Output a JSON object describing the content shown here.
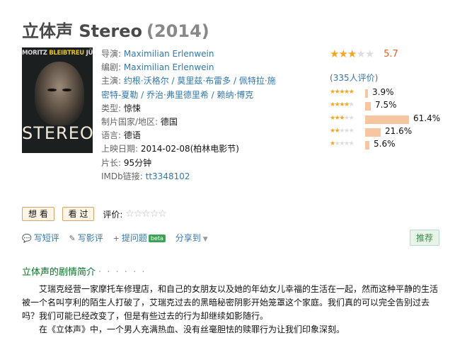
{
  "title": {
    "name": "立体声 Stereo",
    "year": "(2014)"
  },
  "poster": {
    "names_pre": "MORITZ ",
    "names_hl": "BLEIBTREU",
    "names_post": " JÜRGEN VOGEL",
    "logo": "STEREO"
  },
  "info": {
    "director_label": "导演:",
    "director": "Maximilian Erlenwein",
    "writer_label": "编剧:",
    "writer": "Maximilian Erlenwein",
    "cast_label": "主演:",
    "cast_line1": "约根·沃格尔 / 莫里兹·布雷多 / 佩特拉·施",
    "cast_line2": "密特-夏勒 / 乔治·弗里德里希 / 赖纳·博克",
    "genre_label": "类型:",
    "genre": "惊悚",
    "country_label": "制片国家/地区:",
    "country": "德国",
    "language_label": "语言:",
    "language": "德语",
    "release_label": "上映日期:",
    "release": "2014-02-08(柏林电影节)",
    "runtime_label": "片长:",
    "runtime": "95分钟",
    "imdb_label": "IMDb链接:",
    "imdb": "tt3348102"
  },
  "rating": {
    "score": "5.7",
    "stars_filled": 3,
    "count_prefix": "(",
    "count_link": "335人评价",
    "count_suffix": ")",
    "breakdown": [
      {
        "stars": 5,
        "percent": 3.9,
        "label": "3.9%"
      },
      {
        "stars": 4,
        "percent": 7.5,
        "label": "7.5%"
      },
      {
        "stars": 3,
        "percent": 61.4,
        "label": "61.4%"
      },
      {
        "stars": 2,
        "percent": 21.6,
        "label": "21.6%"
      },
      {
        "stars": 1,
        "percent": 5.6,
        "label": "5.6%"
      }
    ]
  },
  "buttons": {
    "want": "想 看",
    "seen": "看 过",
    "rate_label": "评价:"
  },
  "actions": {
    "write_short": "写短评",
    "write_review": "写影评",
    "add_question": "提问题",
    "beta": "beta",
    "share": "分享到",
    "recommend": "推荐"
  },
  "section": {
    "title": "立体声的剧情简介",
    "dots": "· · · · · ·"
  },
  "summary": {
    "p1": "艾瑞克经营一家摩托车修理店，和自己的女朋友以及她的年幼女儿幸福的生活在一起，然而这种平静的生活被一个名叫亨利的陌生人打破了，艾瑞克过去的黑暗秘密阴影开始笼罩这个家庭。我们真的可以完全告别过去吗？我们可能已经改变了，但是有些过去的行为却继续如影随行。",
    "p2": "在《立体声》中，一个男人充满热血、没有丝毫胆怯的赎罪行为让我们印象深刻。"
  },
  "colors": {
    "link": "#3377aa",
    "star": "#f5a623",
    "score": "#e0632a",
    "bar": "#f7c5a0",
    "section": "#007722"
  }
}
